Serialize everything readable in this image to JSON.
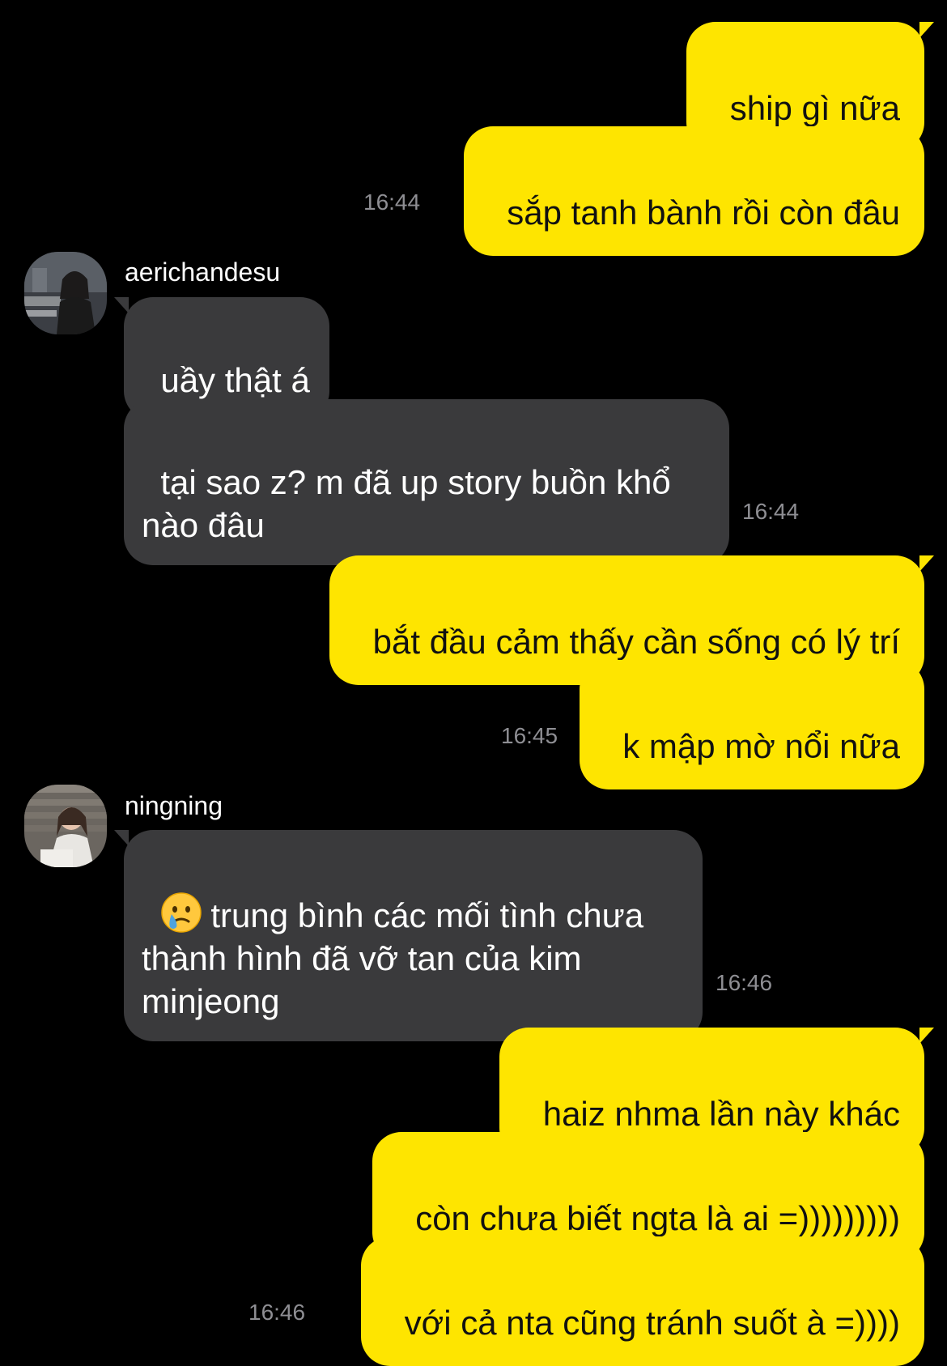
{
  "theme": {
    "background": "#000000",
    "outgoing_bubble": "#FEE500",
    "incoming_bubble": "#3A3A3C",
    "timestamp_color": "#8E8E93"
  },
  "chat": {
    "group1": {
      "msg1": "ship gì nữa",
      "msg2": "sắp tanh bành rồi còn đâu",
      "time": "16:44"
    },
    "group2": {
      "sender": "aerichandesu",
      "avatar_icon": "user-avatar-photo",
      "msg1": "uầy thật á",
      "msg2": "tại sao z? m đã up story buồn khổ\nnào đâu",
      "time": "16:44"
    },
    "group3": {
      "msg1": "bắt đầu cảm thấy cần sống có lý trí",
      "msg2": "k mập mờ nổi nữa",
      "time": "16:45"
    },
    "group4": {
      "sender": "ningning",
      "avatar_icon": "user-avatar-photo",
      "emoji_icon": "crying-face-emoji",
      "msg1": "trung bình các mối tình chưa\nthành hình đã vỡ tan của kim\nminjeong",
      "time": "16:46"
    },
    "group5": {
      "msg1": "haiz nhma lần này khác",
      "msg2": "còn chưa biết ngta là ai =)))))))))",
      "msg3": "với cả nta cũng tránh suốt à =))))",
      "time": "16:46"
    }
  }
}
